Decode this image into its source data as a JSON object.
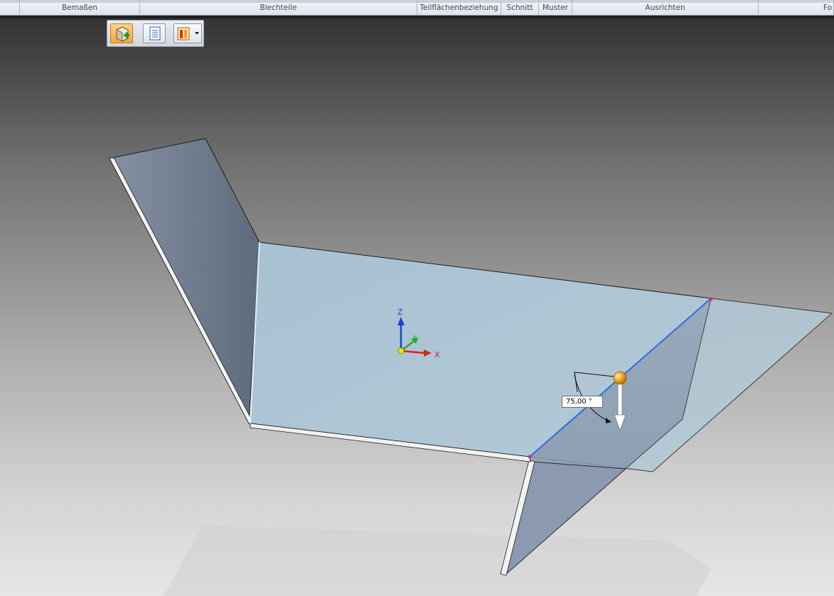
{
  "ribbon": {
    "groups": [
      {
        "label": ""
      },
      {
        "label": "Bemaßen"
      },
      {
        "label": "Blechteile"
      },
      {
        "label": "Teilflächenbeziehung"
      },
      {
        "label": "Schnitt"
      },
      {
        "label": "Muster"
      },
      {
        "label": "Ausrichten"
      },
      {
        "label": "Fo"
      }
    ]
  },
  "quickbar": {
    "buttons": [
      {
        "icon": "add-feature-icon",
        "state": "active"
      },
      {
        "icon": "properties-list-icon",
        "state": "normal"
      },
      {
        "icon": "sheet-metal-option-icon",
        "state": "normal"
      }
    ]
  },
  "viewport": {
    "triad": {
      "x_label": "X",
      "y_label": "Y",
      "z_label": "Z"
    },
    "angle_input": {
      "value": "75,00 °"
    },
    "colors": {
      "face_blue": "#a9c3d3",
      "flange_gray": "#7c8a9c",
      "edge_highlight": "#2f6fd6",
      "handle_orange": "#f0a020",
      "x_axis": "#e02020",
      "y_axis": "#22aa22",
      "z_axis": "#2040d0"
    }
  }
}
